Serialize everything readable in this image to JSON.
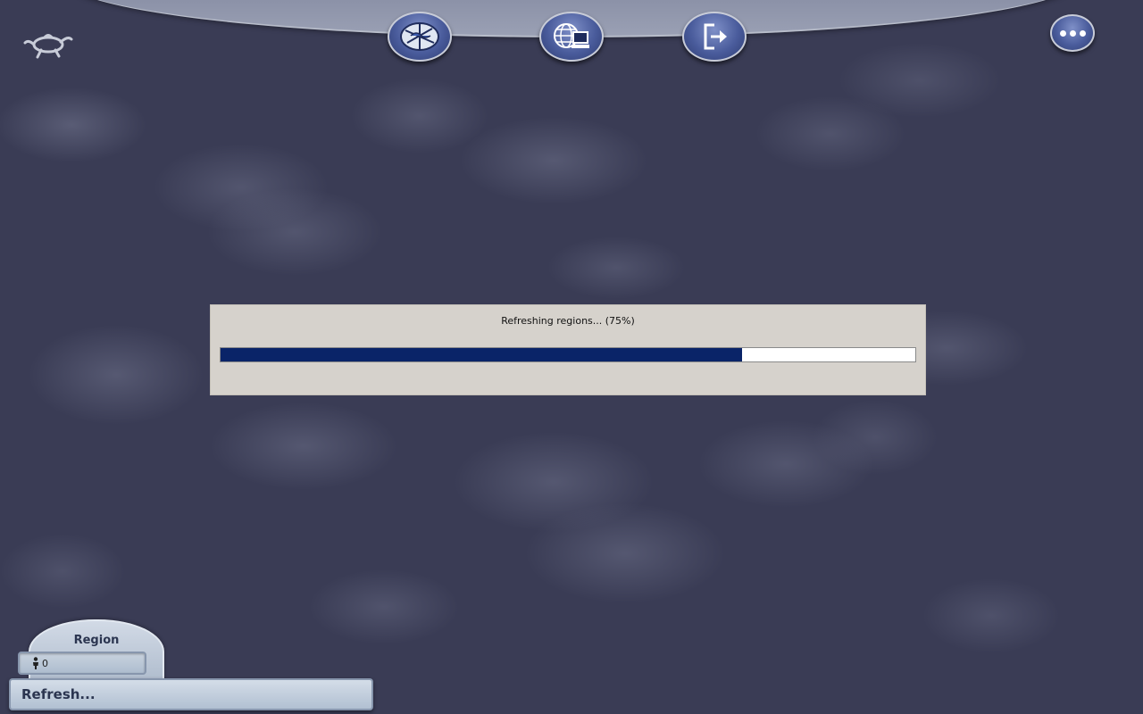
{
  "toolbar": {
    "buttons": [
      {
        "name": "regions",
        "icon": "region-map-icon"
      },
      {
        "name": "neighborhoods",
        "icon": "globe-computer-icon"
      },
      {
        "name": "exit",
        "icon": "exit-arrow-icon"
      },
      {
        "name": "more",
        "icon": "ellipsis-icon"
      }
    ],
    "logo_icon": "turtle-logo-icon"
  },
  "dialog": {
    "message": "Refreshing regions... (75%)",
    "progress_percent": 75
  },
  "region_panel": {
    "title": "Region",
    "population": "0",
    "status_text": "Refresh..."
  },
  "colors": {
    "background": "#3a3c55",
    "progress_fill": "#0a2468",
    "dialog_bg": "#d6d2cc",
    "panel_text": "#2b3550"
  }
}
